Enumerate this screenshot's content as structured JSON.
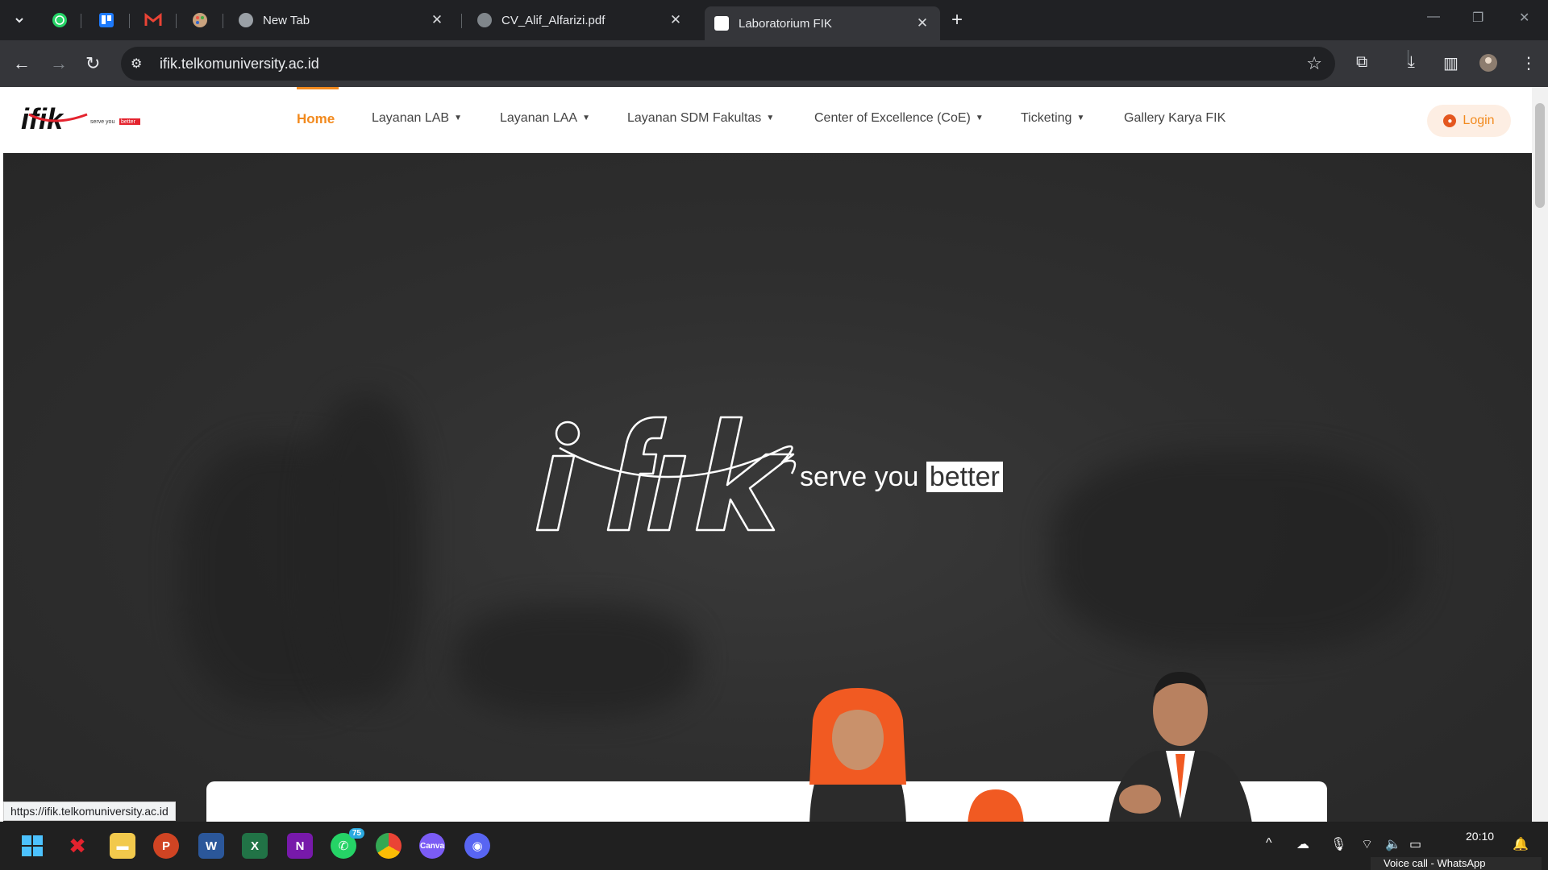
{
  "browser": {
    "tabs": [
      {
        "title": "New Tab"
      },
      {
        "title": "CV_Alif_Alfarizi.pdf"
      },
      {
        "title": "Laboratorium FIK"
      }
    ],
    "url": "ifik.telkomuniversity.ac.id",
    "status_url": "https://ifik.telkomuniversity.ac.id"
  },
  "site": {
    "nav": {
      "home": "Home",
      "layanan_lab": "Layanan LAB",
      "layanan_laa": "Layanan LAA",
      "layanan_sdm": "Layanan SDM Fakultas",
      "coe": "Center of Excellence (CoE)",
      "ticketing": "Ticketing",
      "gallery": "Gallery Karya FIK"
    },
    "login": "Login",
    "tagline_part1": "serve you",
    "tagline_part2": "better",
    "logo_text": "ifik",
    "logo_tag": "serve you better"
  },
  "taskbar": {
    "whatsapp_badge": "75",
    "clock": "20:10",
    "voice_call": "Voice call - WhatsApp"
  },
  "colors": {
    "accent": "#f28a1e",
    "chrome_dark": "#202124"
  }
}
